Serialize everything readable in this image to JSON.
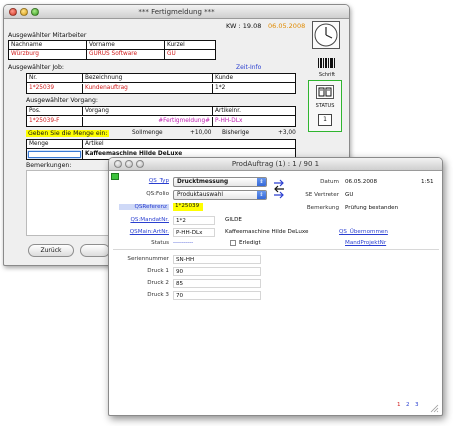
{
  "window1": {
    "title": "*** Fertigmeldung ***",
    "kw": "KW : 19.08",
    "date": "06.05.2008",
    "mitarbeiter": {
      "section": "Ausgewählter Mitarbeiter",
      "headers": [
        "Nachname",
        "Vorname",
        "Kurzel"
      ],
      "values": [
        "Würzburg",
        "GURUS Software",
        "GU"
      ]
    },
    "job": {
      "section": "Ausgewählter Job:",
      "link": "Zeit-Info",
      "headers": [
        "Nr.",
        "Bezeichnung",
        "Kunde"
      ],
      "values": [
        "1*25039",
        "Kundenauftrag",
        "1*2"
      ]
    },
    "vorgang": {
      "section": "Ausgewählter Vorgang:",
      "headers": [
        "Pos.",
        "Vorgang",
        "Artikelnr."
      ],
      "values": [
        "1*25039-F",
        "#Fertigmeldung#",
        "P-HH-DLx"
      ]
    },
    "prompt": "Geben Sie die Menge ein:",
    "sollmenge_label": "Sollmenge",
    "sollmenge_value": "+10,00",
    "bisherige_label": "Bisherige",
    "bisherige_value": "+3,00",
    "menge_label": "Menge",
    "artikel_label": "Artikel",
    "artikel_value": "Kaffeemaschine Hilde DeLuxe",
    "bemerkungen_label": "Bemerkungen:",
    "back_button": "Zurück",
    "side": {
      "barcode_label": "Schrift",
      "status_label": "STATUS",
      "counter_value": "1"
    }
  },
  "window2": {
    "title": "ProdAuftrag (1) : 1 / 90 1",
    "qs_typ_label": "QS_Typ",
    "qs_typ_value": "Drucktmessung",
    "qs_folio_label": "QS:Folio",
    "qs_folio_value": "Produktauswahl",
    "qs_referenz_label": "QSReferenz",
    "qs_referenz_value": "1*25039",
    "qs_mandat_label": "QS:MandatNr.",
    "qs_mandat_value": "1*2",
    "gilde_label": "GILDE",
    "qs_main_label": "QSMain:ArtNr.",
    "qs_main_value": "P-HH-DLx",
    "artikel_name": "Kaffeemaschine Hilde DeLuxe",
    "status_label": "Status",
    "status_value": "----------",
    "erledigt_label": "Erledigt",
    "datum_label": "Datum",
    "datum_value": "06.05.2008",
    "time_value": "1:51",
    "se_vertreter_label": "SE Vertreter",
    "se_vertreter_value": "GU",
    "bemerkung_label": "Bemerkung",
    "bemerkung_value": "Prüfung bestanden",
    "qs_ubernommen_label": "QS_Übernommen",
    "mandprojekt_label": "MandProjektNr",
    "seriennummer_label": "Seriennummer",
    "seriennummer_value": "SN-HH",
    "druck1_label": "Druck 1",
    "druck1_value": "90",
    "druck2_label": "Druck 2",
    "druck2_value": "85",
    "druck3_label": "Druck 3",
    "druck3_value": "70",
    "pager": [
      "1",
      "2",
      "3"
    ]
  },
  "colors": {
    "accent_red": "#d11c1c",
    "link_blue": "#2a3fd0",
    "highlight_yellow": "#ffff00"
  }
}
